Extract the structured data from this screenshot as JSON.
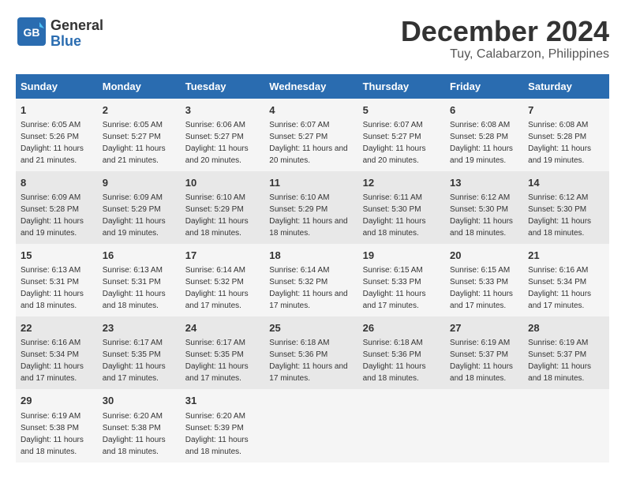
{
  "logo": {
    "text_general": "General",
    "text_blue": "Blue"
  },
  "header": {
    "month": "December 2024",
    "location": "Tuy, Calabarzon, Philippines"
  },
  "columns": [
    "Sunday",
    "Monday",
    "Tuesday",
    "Wednesday",
    "Thursday",
    "Friday",
    "Saturday"
  ],
  "weeks": [
    [
      {
        "day": "1",
        "sunrise": "6:05 AM",
        "sunset": "5:26 PM",
        "daylight": "11 hours and 21 minutes."
      },
      {
        "day": "2",
        "sunrise": "6:05 AM",
        "sunset": "5:27 PM",
        "daylight": "11 hours and 21 minutes."
      },
      {
        "day": "3",
        "sunrise": "6:06 AM",
        "sunset": "5:27 PM",
        "daylight": "11 hours and 20 minutes."
      },
      {
        "day": "4",
        "sunrise": "6:07 AM",
        "sunset": "5:27 PM",
        "daylight": "11 hours and 20 minutes."
      },
      {
        "day": "5",
        "sunrise": "6:07 AM",
        "sunset": "5:27 PM",
        "daylight": "11 hours and 20 minutes."
      },
      {
        "day": "6",
        "sunrise": "6:08 AM",
        "sunset": "5:28 PM",
        "daylight": "11 hours and 19 minutes."
      },
      {
        "day": "7",
        "sunrise": "6:08 AM",
        "sunset": "5:28 PM",
        "daylight": "11 hours and 19 minutes."
      }
    ],
    [
      {
        "day": "8",
        "sunrise": "6:09 AM",
        "sunset": "5:28 PM",
        "daylight": "11 hours and 19 minutes."
      },
      {
        "day": "9",
        "sunrise": "6:09 AM",
        "sunset": "5:29 PM",
        "daylight": "11 hours and 19 minutes."
      },
      {
        "day": "10",
        "sunrise": "6:10 AM",
        "sunset": "5:29 PM",
        "daylight": "11 hours and 18 minutes."
      },
      {
        "day": "11",
        "sunrise": "6:10 AM",
        "sunset": "5:29 PM",
        "daylight": "11 hours and 18 minutes."
      },
      {
        "day": "12",
        "sunrise": "6:11 AM",
        "sunset": "5:30 PM",
        "daylight": "11 hours and 18 minutes."
      },
      {
        "day": "13",
        "sunrise": "6:12 AM",
        "sunset": "5:30 PM",
        "daylight": "11 hours and 18 minutes."
      },
      {
        "day": "14",
        "sunrise": "6:12 AM",
        "sunset": "5:30 PM",
        "daylight": "11 hours and 18 minutes."
      }
    ],
    [
      {
        "day": "15",
        "sunrise": "6:13 AM",
        "sunset": "5:31 PM",
        "daylight": "11 hours and 18 minutes."
      },
      {
        "day": "16",
        "sunrise": "6:13 AM",
        "sunset": "5:31 PM",
        "daylight": "11 hours and 18 minutes."
      },
      {
        "day": "17",
        "sunrise": "6:14 AM",
        "sunset": "5:32 PM",
        "daylight": "11 hours and 17 minutes."
      },
      {
        "day": "18",
        "sunrise": "6:14 AM",
        "sunset": "5:32 PM",
        "daylight": "11 hours and 17 minutes."
      },
      {
        "day": "19",
        "sunrise": "6:15 AM",
        "sunset": "5:33 PM",
        "daylight": "11 hours and 17 minutes."
      },
      {
        "day": "20",
        "sunrise": "6:15 AM",
        "sunset": "5:33 PM",
        "daylight": "11 hours and 17 minutes."
      },
      {
        "day": "21",
        "sunrise": "6:16 AM",
        "sunset": "5:34 PM",
        "daylight": "11 hours and 17 minutes."
      }
    ],
    [
      {
        "day": "22",
        "sunrise": "6:16 AM",
        "sunset": "5:34 PM",
        "daylight": "11 hours and 17 minutes."
      },
      {
        "day": "23",
        "sunrise": "6:17 AM",
        "sunset": "5:35 PM",
        "daylight": "11 hours and 17 minutes."
      },
      {
        "day": "24",
        "sunrise": "6:17 AM",
        "sunset": "5:35 PM",
        "daylight": "11 hours and 17 minutes."
      },
      {
        "day": "25",
        "sunrise": "6:18 AM",
        "sunset": "5:36 PM",
        "daylight": "11 hours and 17 minutes."
      },
      {
        "day": "26",
        "sunrise": "6:18 AM",
        "sunset": "5:36 PM",
        "daylight": "11 hours and 18 minutes."
      },
      {
        "day": "27",
        "sunrise": "6:19 AM",
        "sunset": "5:37 PM",
        "daylight": "11 hours and 18 minutes."
      },
      {
        "day": "28",
        "sunrise": "6:19 AM",
        "sunset": "5:37 PM",
        "daylight": "11 hours and 18 minutes."
      }
    ],
    [
      {
        "day": "29",
        "sunrise": "6:19 AM",
        "sunset": "5:38 PM",
        "daylight": "11 hours and 18 minutes."
      },
      {
        "day": "30",
        "sunrise": "6:20 AM",
        "sunset": "5:38 PM",
        "daylight": "11 hours and 18 minutes."
      },
      {
        "day": "31",
        "sunrise": "6:20 AM",
        "sunset": "5:39 PM",
        "daylight": "11 hours and 18 minutes."
      },
      null,
      null,
      null,
      null
    ]
  ],
  "cell_labels": {
    "sunrise": "Sunrise: ",
    "sunset": "Sunset: ",
    "daylight": "Daylight: "
  }
}
